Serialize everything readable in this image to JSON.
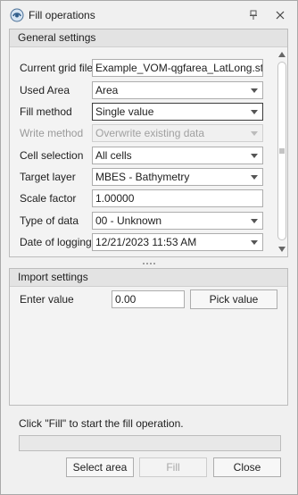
{
  "window": {
    "title": "Fill operations"
  },
  "general_settings": {
    "header": "General settings",
    "rows": [
      {
        "label": "Current grid file",
        "value": "Example_VOM-qgfarea_LatLong.statg",
        "type": "text"
      },
      {
        "label": "Used Area",
        "value": "Area",
        "type": "combo"
      },
      {
        "label": "Fill method",
        "value": "Single value",
        "type": "combo"
      },
      {
        "label": "Write method",
        "value": "Overwrite existing data",
        "type": "combo-disabled"
      },
      {
        "label": "Cell selection",
        "value": "All cells",
        "type": "combo"
      },
      {
        "label": "Target layer",
        "value": "MBES - Bathymetry",
        "type": "combo"
      },
      {
        "label": "Scale factor",
        "value": "1.00000",
        "type": "text"
      },
      {
        "label": "Type of data",
        "value": "00 - Unknown",
        "type": "combo"
      },
      {
        "label": "Date of logging",
        "value": "12/21/2023 11:53 AM",
        "type": "combo"
      }
    ]
  },
  "import_settings": {
    "header": "Import settings",
    "enter_value_label": "Enter value",
    "enter_value": "0.00",
    "pick_value_label": "Pick value"
  },
  "footer": {
    "status": "Click \"Fill\" to start the fill operation.",
    "progress": 0,
    "select_area_label": "Select area",
    "fill_label": "Fill",
    "close_label": "Close"
  },
  "icons": {
    "app": "fill-app-icon",
    "pin": "pin-icon",
    "close": "close-icon"
  },
  "colors": {
    "accent": "#3a7bd5"
  }
}
